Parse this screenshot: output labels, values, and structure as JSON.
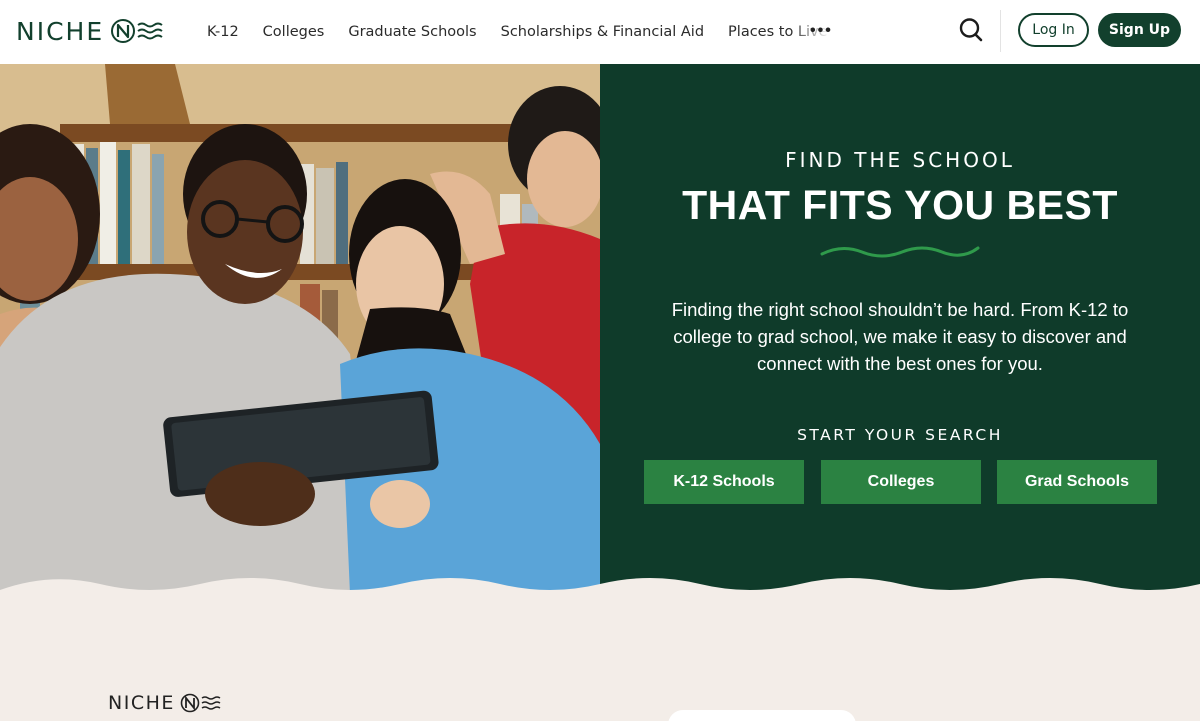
{
  "brand": {
    "name": "NICHE"
  },
  "nav": {
    "items": [
      {
        "label": "K-12"
      },
      {
        "label": "Colleges"
      },
      {
        "label": "Graduate Schools"
      },
      {
        "label": "Scholarships & Financial Aid"
      },
      {
        "label": "Places to Live"
      }
    ],
    "more_label": "•••"
  },
  "header": {
    "login_label": "Log In",
    "signup_label": "Sign Up"
  },
  "hero": {
    "eyebrow": "FIND THE SCHOOL",
    "headline": "THAT FITS YOU BEST",
    "description": "Finding the right school shouldn’t be hard. From K-12 to college to grad school, we make it easy to discover and connect with the best ones for you.",
    "search_label": "START YOUR SEARCH",
    "buttons": [
      {
        "label": "K-12 Schools"
      },
      {
        "label": "Colleges"
      },
      {
        "label": "Grad Schools"
      }
    ]
  },
  "footer": {
    "logo_text": "NICHE"
  },
  "colors": {
    "brand_dark_green": "#0f3b2a",
    "cta_green": "#2b8242",
    "accent_squiggle": "#2f9a4b",
    "page_bg": "#f3ede8"
  },
  "icons": {
    "logo_mark": "niche-n-wave-icon",
    "search": "search-icon",
    "decorative_squiggle": "squiggle-divider"
  }
}
